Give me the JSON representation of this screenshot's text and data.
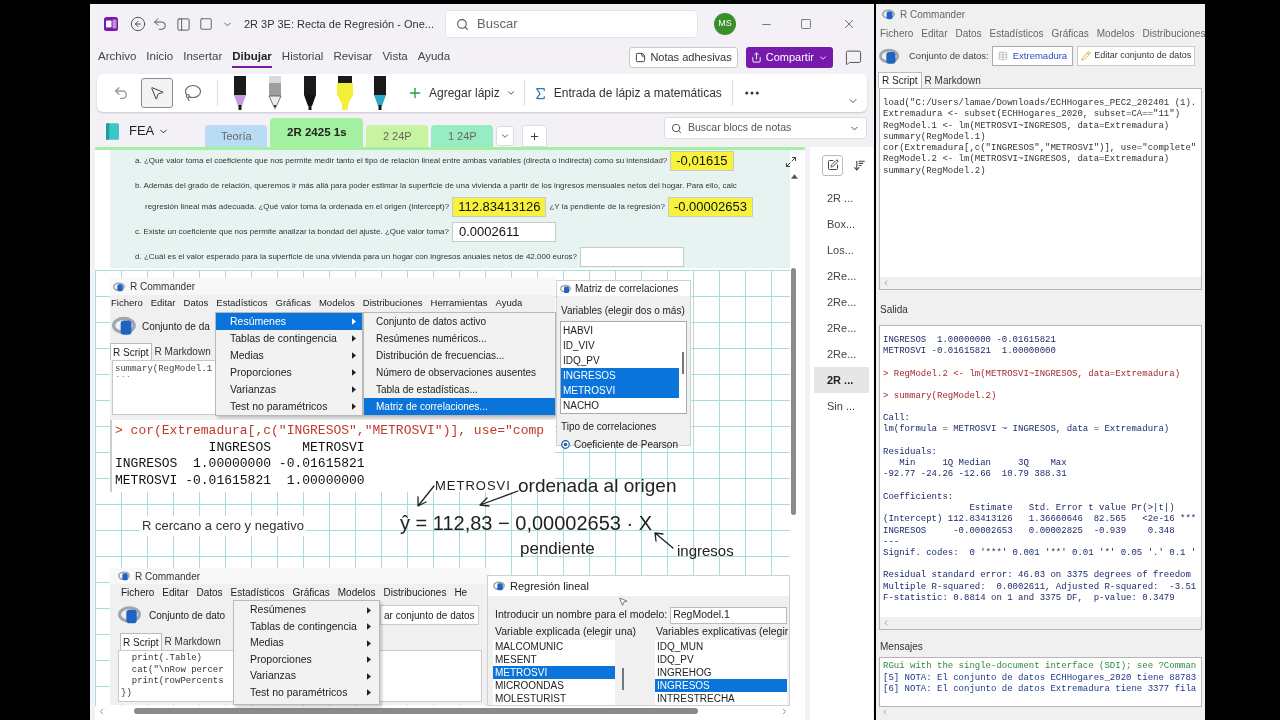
{
  "onenote": {
    "title": "2R 3P 3E: Recta de Regresión - One...",
    "search": {
      "placeholder": "Buscar"
    },
    "avatar": "MS",
    "ribbon_tabs": [
      {
        "label": "Archivo",
        "selected": false
      },
      {
        "label": "Inicio",
        "selected": false
      },
      {
        "label": "Insertar",
        "selected": false
      },
      {
        "label": "Dibujar",
        "selected": true
      },
      {
        "label": "Historial",
        "selected": false
      },
      {
        "label": "Revisar",
        "selected": false
      },
      {
        "label": "Vista",
        "selected": false
      },
      {
        "label": "Ayuda",
        "selected": false
      }
    ],
    "sticky_notes_button": "Notas adhesivas",
    "share_button": "Compartir",
    "draw_toolbar": {
      "tools": [
        {
          "kind": "undo",
          "selected": false
        },
        {
          "kind": "select",
          "selected": true
        },
        {
          "kind": "lasso",
          "selected": false
        }
      ],
      "pens": [
        {
          "kind": "pen",
          "color": "#c79ae0"
        },
        {
          "kind": "pencil",
          "color": "#9e9e9e"
        },
        {
          "kind": "pen",
          "color": "#111111"
        },
        {
          "kind": "highlighter",
          "color": "#f4ef3a"
        },
        {
          "kind": "pen",
          "color": "#2aa7c9"
        }
      ],
      "add_pen": "Agregar lápiz",
      "ink_to_math": "Entrada de lápiz a matemáticas"
    },
    "notebook": "FEA",
    "section_tabs": [
      {
        "label": "Teoría",
        "color": "#b9dcf5",
        "selected": false
      },
      {
        "label": "2R 2425 1s",
        "color": "#a3f0a0",
        "selected": true
      },
      {
        "label": "2 24P",
        "color": "#c8f3a0",
        "selected": false
      },
      {
        "label": "1 24P",
        "color": "#98ecc4",
        "selected": false
      }
    ],
    "notebook_search": {
      "placeholder": "Buscar blocs de notas"
    },
    "questions": [
      {
        "rows": [
          [
            {
              "kind": "text",
              "text": "a. ¿Qué valor toma el coeficiente que nos permite medir tanto el tipo de relación lineal entre ambas variables (directa o indirecta) como su intensidad?"
            },
            {
              "kind": "answer",
              "value": "-0,01615",
              "highlighted": true
            }
          ]
        ]
      },
      {
        "rows": [
          [
            {
              "kind": "text",
              "text": "b. Además del grado de relación, queremos ir más allá para poder estimar la superficie de una vivienda a partir de los ingresos mensuales netos del hogar. Para ello, calc"
            }
          ],
          [
            {
              "kind": "text",
              "text": "regresión lineal más adecuada. ¿Qué valor toma la ordenada en el origen (intercept)?"
            },
            {
              "kind": "answer",
              "value": "112.83413126",
              "highlighted": true
            },
            {
              "kind": "text",
              "text": "¿Y la pendiente de la regresión?"
            },
            {
              "kind": "answer",
              "value": "-0.00002653",
              "highlighted": true
            }
          ]
        ]
      },
      {
        "rows": [
          [
            {
              "kind": "text",
              "text": "c. Existe un coeficiente que nos permite analizar la bondad del ajuste. ¿Qué valor toma?"
            },
            {
              "kind": "answer",
              "value": "0.0002611",
              "highlighted": false
            }
          ]
        ]
      },
      {
        "rows": [
          [
            {
              "kind": "text",
              "text": "d. ¿Cuál es el valor esperado para la superficie de una vivienda para un hogar con ingresos anuales netos de 42.000 euros?"
            },
            {
              "kind": "answer",
              "highlighted": false
            }
          ]
        ]
      }
    ],
    "page_canvas": {
      "capture_1": {
        "title": "R Commander",
        "menu": [
          "Fichero",
          "Editar",
          "Datos",
          "Estadísticos",
          "Gráficas",
          "Modelos",
          "Distribuciones",
          "Herramientas",
          "Ayuda"
        ],
        "dataset_label": "Conjunto de da",
        "tabs": [
          {
            "label": "R Script",
            "selected": true
          },
          {
            "label": "R Markdown",
            "selected": false
          }
        ],
        "script": [
          "summary(RegModel.1",
          "```"
        ],
        "menu_popup": [
          {
            "label": "Resúmenes",
            "selected": true
          },
          {
            "label": "Tablas de contingencia",
            "selected": false
          },
          {
            "label": "Medias",
            "selected": false
          },
          {
            "label": "Proporciones",
            "selected": false
          },
          {
            "label": "Varianzas",
            "selected": false
          },
          {
            "label": "Test no paramétricos",
            "selected": false
          }
        ],
        "submenu_popup": [
          {
            "label": "Conjunto de datos activo",
            "selected": false
          },
          {
            "label": "Resúmenes numéricos...",
            "selected": false
          },
          {
            "label": "Distribución de frecuencias...",
            "selected": false
          },
          {
            "label": "Número de observaciones ausentes",
            "selected": false
          },
          {
            "label": "Tabla de estadísticas...",
            "selected": false
          },
          {
            "label": "Matriz de correlaciones...",
            "selected": true
          }
        ]
      },
      "correlation_dialog": {
        "title": "Matriz de correlaciones",
        "variables_label": "Variables (elegir dos o más)",
        "variables": [
          {
            "label": "HABVI",
            "selected": false
          },
          {
            "label": "ID_VIV",
            "selected": false
          },
          {
            "label": "IDQ_PV",
            "selected": false
          },
          {
            "label": "INGRESOS",
            "selected": true
          },
          {
            "label": "METROSVI",
            "selected": true
          },
          {
            "label": "NACHO",
            "selected": false
          }
        ],
        "type_label": "Tipo de correlaciones",
        "options": [
          {
            "label": "Coeficiente de Pearson",
            "selected": true
          }
        ]
      },
      "console": {
        "command": "> cor(Extremadura[,c(\"INGRESOS\",\"METROSVI\")], use=\"comp",
        "table": [
          "            INGRESOS    METROSVI",
          "INGRESOS  1.00000000 -0.01615821",
          "METROSVI -0.01615821  1.00000000"
        ]
      },
      "note": "R cercano a cero y negativo",
      "ink": {
        "response_label": "METROSVI",
        "intercept_label": "ordenada al origen",
        "equation": "ŷ = 112,83 − 0,00002653 · X",
        "slope_label": "pendiente",
        "predictor_label": "ingresos"
      },
      "capture_2": {
        "title": "R Commander",
        "menu": [
          "Fichero",
          "Editar",
          "Datos",
          "Estadísticos",
          "Gráficas",
          "Modelos",
          "Distribuciones",
          "He"
        ],
        "dataset_label": "Conjunto de dato",
        "edit_button": "ar conjunto de datos",
        "tabs": [
          {
            "label": "R Script",
            "selected": true
          },
          {
            "label": "R Markdown",
            "selected": false
          }
        ],
        "script": [
          "  print(.Table)",
          "  cat(\"\\nRow percer",
          "  print(rowPercents",
          "})"
        ],
        "menu_popup": [
          {
            "label": "Resúmenes",
            "selected": false
          },
          {
            "label": "Tablas de contingencia",
            "selected": false
          },
          {
            "label": "Medias",
            "selected": false
          },
          {
            "label": "Proporciones",
            "selected": false
          },
          {
            "label": "Varianzas",
            "selected": false
          },
          {
            "label": "Test no paramétricos",
            "selected": false
          }
        ]
      },
      "regression_dialog": {
        "title": "Regresión lineal",
        "model_name_label": "Introducir un nombre para el modelo:",
        "model_name": "RegModel.1",
        "response_label": "Variable explicada (elegir una)",
        "response_vars": [
          {
            "label": "MALCOMUNIC",
            "selected": false
          },
          {
            "label": "MESENT",
            "selected": false
          },
          {
            "label": "METROSVI",
            "selected": true
          },
          {
            "label": "MICROONDAS",
            "selected": false
          },
          {
            "label": "MOLESTURIST",
            "selected": false
          }
        ],
        "explanatory_label": "Variables explicativas (elegir",
        "explanatory_vars": [
          {
            "label": "IDQ_MUN",
            "selected": false
          },
          {
            "label": "IDQ_PV",
            "selected": false
          },
          {
            "label": "INGREHOG",
            "selected": false
          },
          {
            "label": "INGRESOS",
            "selected": true
          },
          {
            "label": "INTRESTRECHA",
            "selected": false
          }
        ]
      }
    },
    "pages": [
      {
        "label": "2R ...",
        "selected": false
      },
      {
        "label": "Box...",
        "selected": false
      },
      {
        "label": "Los...",
        "selected": false
      },
      {
        "label": "2Re...",
        "selected": false
      },
      {
        "label": "2Re...",
        "selected": false
      },
      {
        "label": "2Re...",
        "selected": false
      },
      {
        "label": "2Re...",
        "selected": false
      },
      {
        "label": "2R ...",
        "selected": true
      },
      {
        "label": "Sin ...",
        "selected": false
      }
    ]
  },
  "rcommander": {
    "title": "R Commander",
    "menu": [
      "Fichero",
      "Editar",
      "Datos",
      "Estadísticos",
      "Gráficas",
      "Modelos",
      "Distribuciones"
    ],
    "dataset_label": "Conjunto de datos:",
    "dataset_button": "Extremadura",
    "edit_button": "Editar conjunto de datos",
    "tabs": [
      {
        "label": "R Script",
        "selected": true
      },
      {
        "label": "R Markdown",
        "selected": false
      }
    ],
    "script": [
      "load(\"C:/Users/lamae/Downloads/ECHHogares_PEC2_202401 (1).",
      "Extremadura <- subset(ECHHogares_2020, subset=CA==\"11\")",
      "RegModel.1 <- lm(METROSVI~INGRESOS, data=Extremadura)",
      "summary(RegModel.1)",
      "cor(Extremadura[,c(\"INGRESOS\",\"METROSVI\")], use=\"complete\"",
      "RegModel.2 <- lm(METROSVI~INGRESOS, data=Extremadura)",
      "summary(RegModel.2)"
    ],
    "output_label": "Salida",
    "output": [
      {
        "kind": "result",
        "lines": [
          "INGRESOS  1.00000000 -0.01615821",
          "METROSVI -0.01615821  1.00000000"
        ]
      },
      {
        "kind": "command",
        "lines": [
          "> RegModel.2 <- lm(METROSVI~INGRESOS, data=Extremadura)"
        ]
      },
      {
        "kind": "command",
        "lines": [
          "> summary(RegModel.2)"
        ]
      },
      {
        "kind": "result",
        "lines": [
          "Call:",
          "lm(formula = METROSVI ~ INGRESOS, data = Extremadura)"
        ]
      },
      {
        "kind": "result",
        "lines": [
          "Residuals:",
          "   Min     1Q Median     3Q    Max",
          "-92.77 -24.26 -12.66  10.79 388.31"
        ]
      },
      {
        "kind": "result",
        "lines": [
          "Coefficients:",
          "                Estimate   Std. Error t value Pr(>|t|)",
          "(Intercept) 112.83413126   1.36660646  82.565   <2e-16 ***",
          "INGRESOS     -0.00002653   0.00002825  -0.939    0.348",
          "---",
          "Signif. codes:  0 '***' 0.001 '**' 0.01 '*' 0.05 '.' 0.1 '"
        ]
      },
      {
        "kind": "result",
        "lines": [
          "Residual standard error: 46.03 on 3375 degrees of freedom",
          "Multiple R-squared:  0.0002611, Adjusted R-squared:  -3.51",
          "F-statistic: 0.8814 on 1 and 3375 DF,  p-value: 0.3479"
        ]
      }
    ],
    "messages_label": "Mensajes",
    "messages": [
      {
        "kind": "info",
        "text": "RGui with the single-document interface (SDI); see ?Comman"
      },
      {
        "kind": "note",
        "text": "[5] NOTA: El conjunto de datos ECHHogares_2020 tiene 88783"
      },
      {
        "kind": "note",
        "text": "[6] NOTA: El conjunto de datos Extremadura tiene 3377 fila"
      }
    ]
  }
}
